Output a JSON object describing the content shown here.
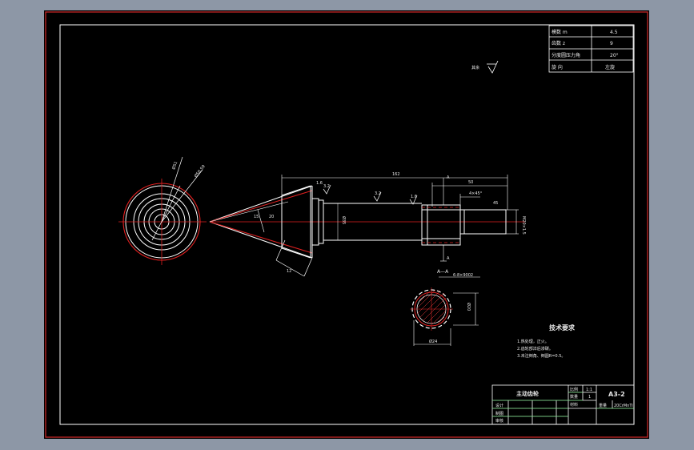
{
  "gear_params": [
    {
      "name": "模数 m",
      "value": "4.5"
    },
    {
      "name": "齿数 z",
      "value": "9"
    },
    {
      "name": "分度圆压力角",
      "value": "20°"
    },
    {
      "name": "旋 向",
      "value": "左旋"
    }
  ],
  "roughness_note": "其余",
  "section_label": "A—A",
  "spline_label": "6-8×9002",
  "tech_req": {
    "title": "技术要求",
    "items": [
      "1.热处理，正火。",
      "2.齿轮部淬后渗碳。",
      "3.未注倒角、倒圆R=0.5。"
    ]
  },
  "title_block": {
    "part_name": "主动齿轮",
    "scale_label": "比例",
    "scale_value": "1:1",
    "qty_label": "数量",
    "qty_value": "1",
    "material_label": "材料",
    "drawing_no": "A3-2",
    "weight_label": "重量",
    "material_value": "20CrMnTi",
    "design_label": "设计",
    "draw_label": "制图",
    "check_label": "审核"
  },
  "colors": {
    "background": "#000000",
    "outer_bg": "#8d97a6",
    "frame_red": "#d42a2a",
    "line_white": "#ffffff",
    "center_red": "#e02020"
  }
}
